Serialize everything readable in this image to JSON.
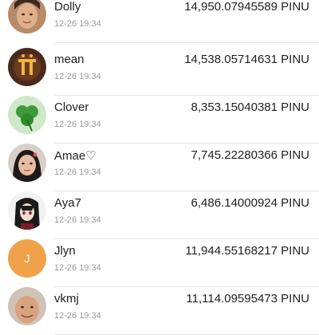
{
  "rows": [
    {
      "name": "Dolly",
      "time": "12-26 19:34",
      "amount": "14,950.07945589 PINU",
      "avatar": "photo-woman-icon"
    },
    {
      "name": "mean",
      "time": "12-26 19:34",
      "amount": "14,538.05714631 PINU",
      "avatar": "pi-logo-icon"
    },
    {
      "name": "Clover",
      "time": "12-26 19:34",
      "amount": "8,353.15040381 PINU",
      "avatar": "clover-icon"
    },
    {
      "name": "Amae♡",
      "time": "12-26 19:34",
      "amount": "7,745.22280366 PINU",
      "avatar": "photo-girl-icon"
    },
    {
      "name": "Aya7",
      "time": "12-26 19:34",
      "amount": "6,486.14000924 PINU",
      "avatar": "anime-character-icon"
    },
    {
      "name": "Jlyn",
      "time": "12-26 19:34",
      "amount": "11,944.55168217 PINU",
      "avatar": "letter-avatar",
      "initial": "J",
      "color": "#efa24a"
    },
    {
      "name": "vkmj",
      "time": "12-26 19:34",
      "amount": "11,114.09595473 PINU",
      "avatar": "photo-man-icon"
    }
  ]
}
